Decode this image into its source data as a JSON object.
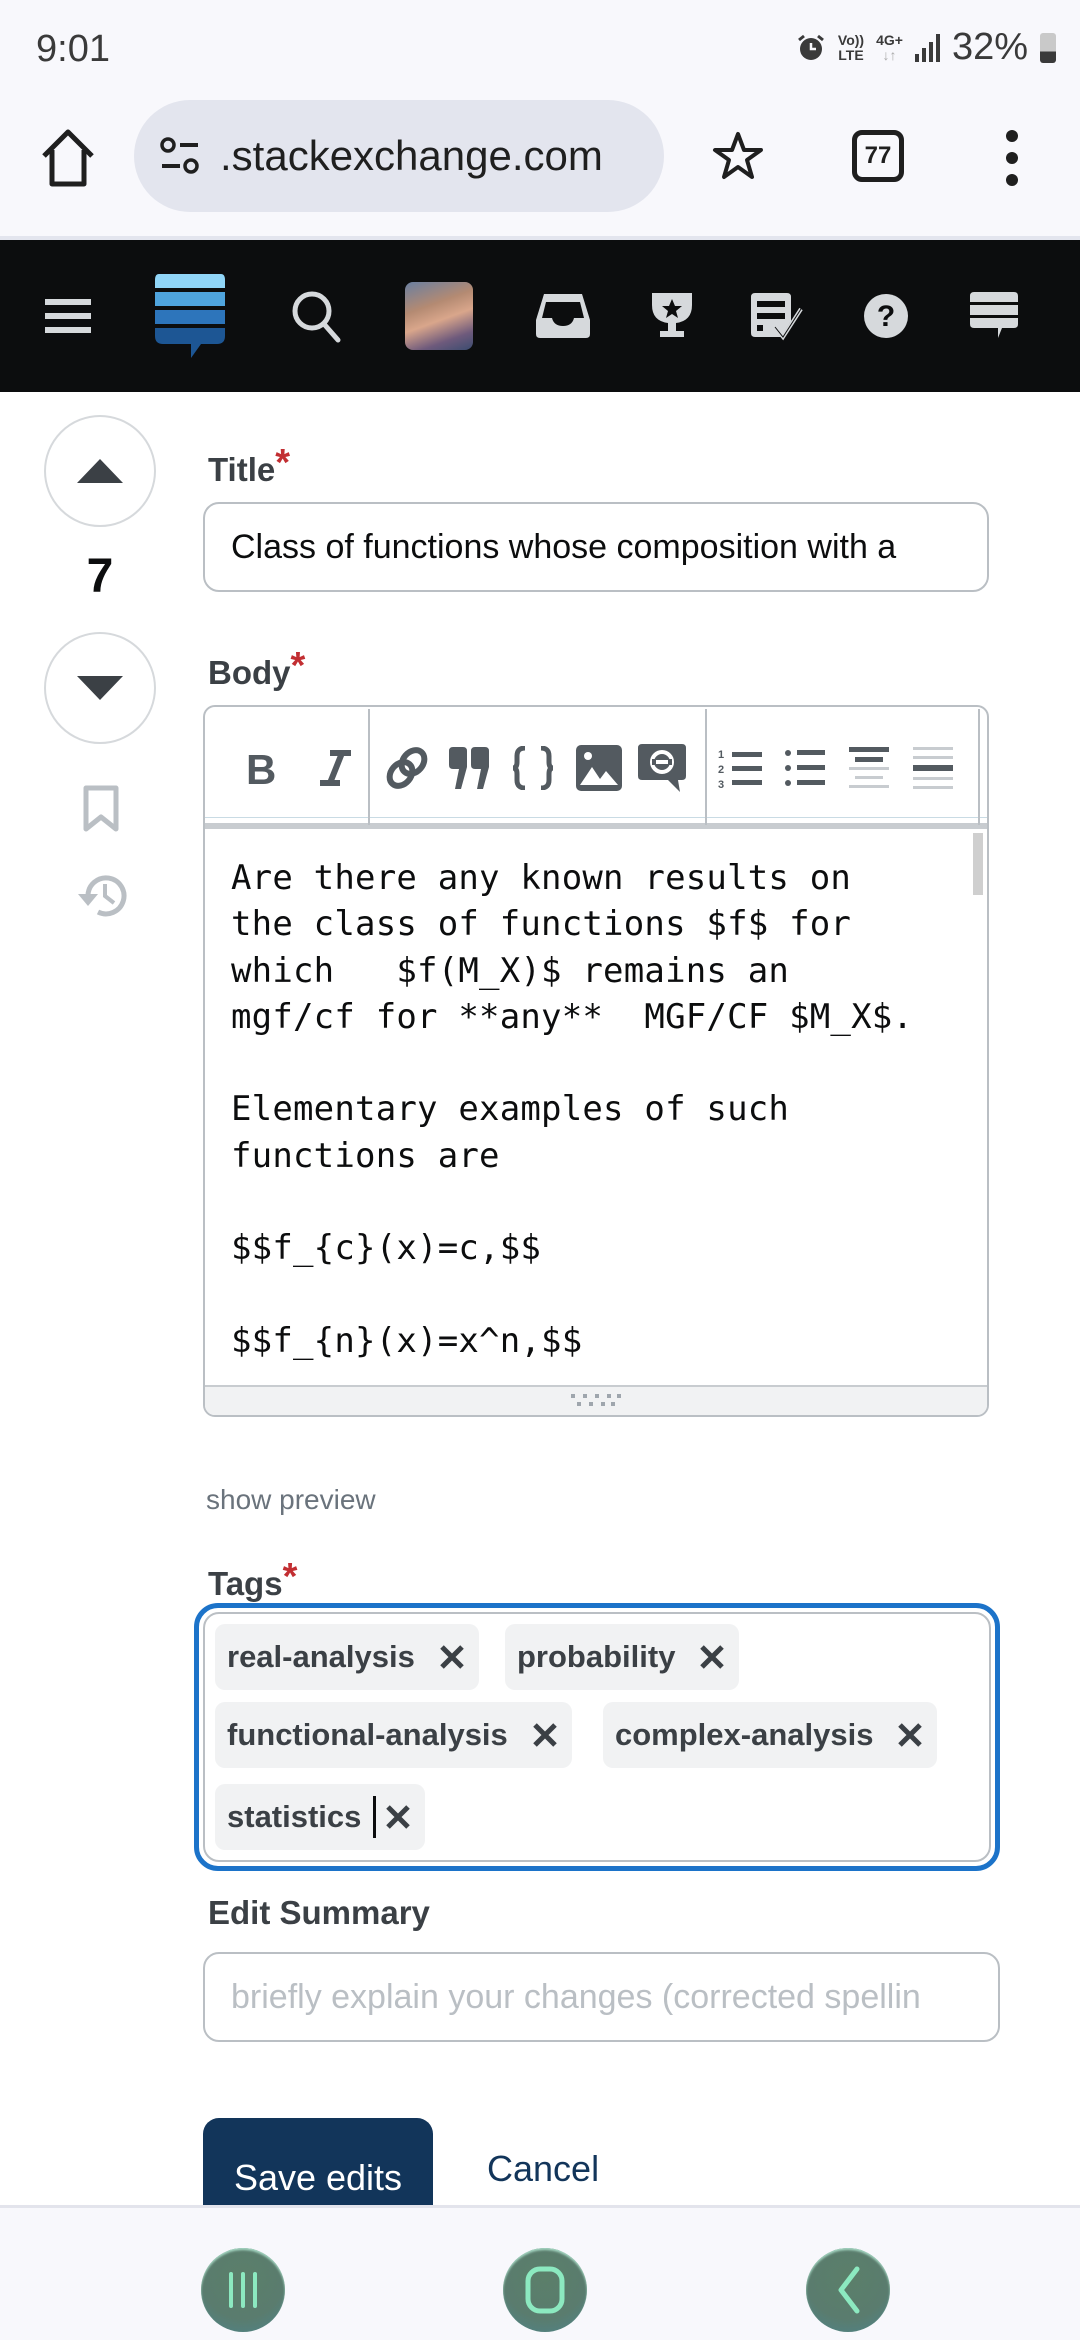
{
  "status_bar": {
    "time": "9:01",
    "volte_top": "Vo))",
    "volte_bottom": "LTE",
    "network_top": "4G+",
    "network_bottom": "↓↑",
    "battery_percent": "32%",
    "icons": [
      "alarm-icon",
      "volte-icon",
      "4g-icon",
      "signal-icon",
      "battery-icon"
    ]
  },
  "browser": {
    "url": ".stackexchange.com",
    "tab_count": "77",
    "icons": [
      "home-icon",
      "site-settings-icon",
      "bookmark-star-icon",
      "tabs-icon",
      "more-menu-icon"
    ]
  },
  "site_nav": {
    "icons": [
      "hamburger-menu-icon",
      "stack-exchange-logo",
      "search-icon",
      "user-avatar",
      "inbox-icon",
      "achievements-trophy-icon",
      "review-queue-icon",
      "help-icon",
      "site-switcher-icon"
    ]
  },
  "votes": {
    "score": "7"
  },
  "form": {
    "title_label": "Title",
    "body_label": "Body",
    "required_marker": "*",
    "title_value": "Class of functions whose composition with a",
    "body_value": "Are there any known results on\nthe class of functions $f$ for\nwhich   $f(M_X)$ remains an\nmgf/cf for **any**  MGF/CF $M_X$.\n\nElementary examples of such\nfunctions are\n\n$$f_{c}(x)=c,$$\n\n$$f_{n}(x)=x^n,$$",
    "toolbar_buttons": [
      "bold",
      "italic",
      "link",
      "blockquote",
      "code",
      "image",
      "snippet",
      "ordered-list",
      "unordered-list",
      "heading",
      "horizontal-rule"
    ],
    "show_preview": "show preview",
    "tags_label": "Tags",
    "tags": [
      "real-analysis",
      "probability",
      "functional-analysis",
      "complex-analysis",
      "statistics"
    ],
    "edit_summary_label": "Edit Summary",
    "edit_summary_placeholder": "briefly explain your changes (corrected spellin",
    "save_label": "Save edits",
    "cancel_label": "Cancel"
  },
  "colors": {
    "accent_focus": "#1c73c9",
    "primary_button": "#12355a",
    "required": "#c22e32",
    "topbar": "#0c0d0e"
  },
  "system_nav": {
    "icons": [
      "recent-apps-icon",
      "home-icon",
      "back-icon"
    ]
  }
}
